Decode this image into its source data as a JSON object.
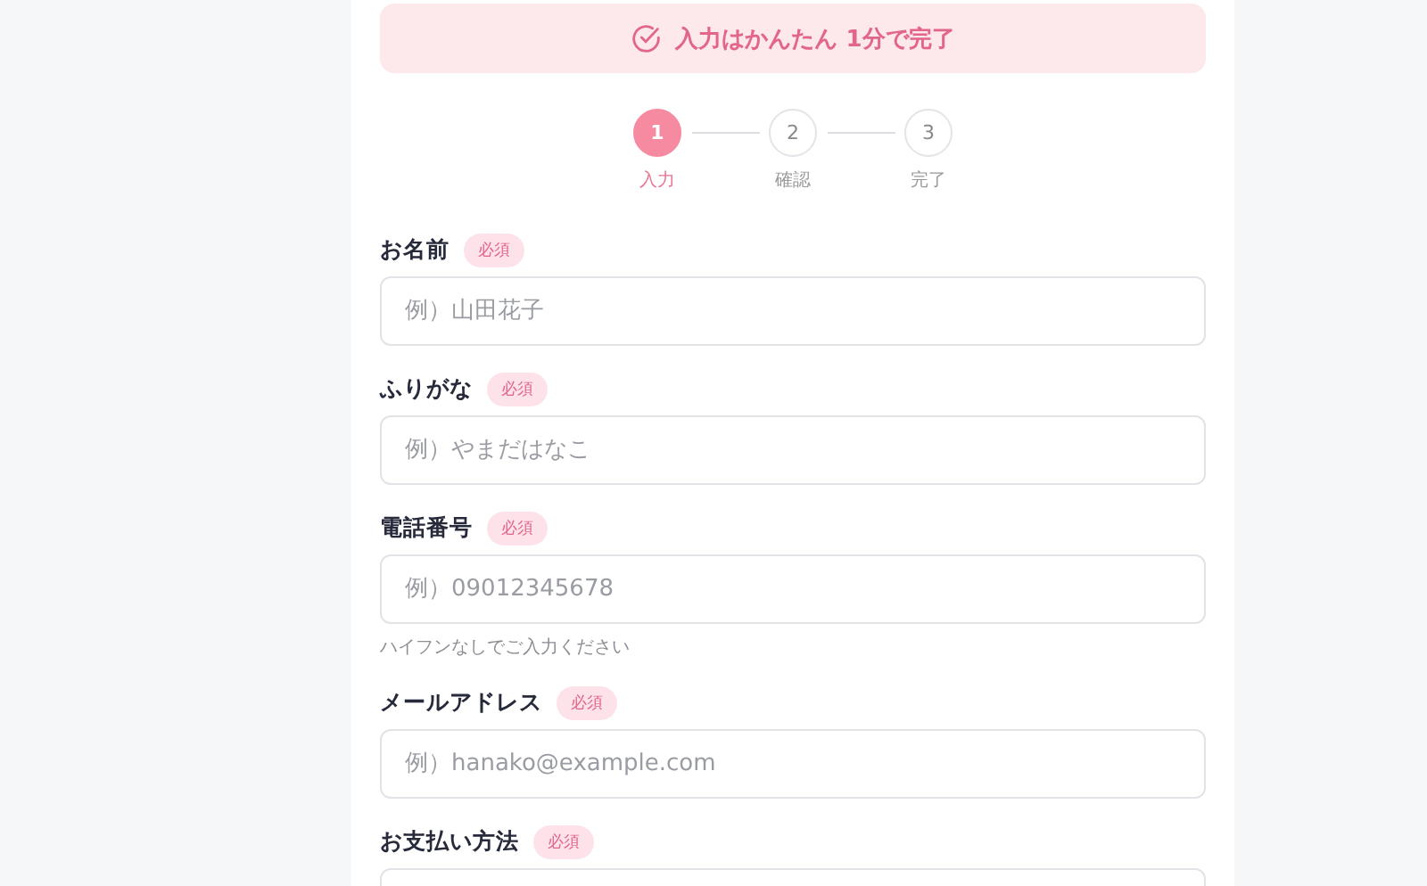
{
  "banner": {
    "text": "入力はかんたん 1分で完了"
  },
  "steps": [
    {
      "number": "1",
      "label": "入力",
      "selected": true
    },
    {
      "number": "2",
      "label": "確認",
      "selected": false
    },
    {
      "number": "3",
      "label": "完了",
      "selected": false
    }
  ],
  "fields": [
    {
      "label": "お名前",
      "badge": "必須",
      "placeholder": "例）山田花子"
    },
    {
      "label": "ふりがな",
      "badge": "必須",
      "placeholder": "例）やまだはなこ"
    },
    {
      "label": "電話番号",
      "badge": "必須",
      "placeholder": "例）09012345678",
      "hint": "ハイフンなしでご入力ください"
    },
    {
      "label": "メールアドレス",
      "badge": "必須",
      "placeholder": "例）hanako@example.com"
    },
    {
      "label": "お支払い方法",
      "badge": "必須"
    }
  ]
}
